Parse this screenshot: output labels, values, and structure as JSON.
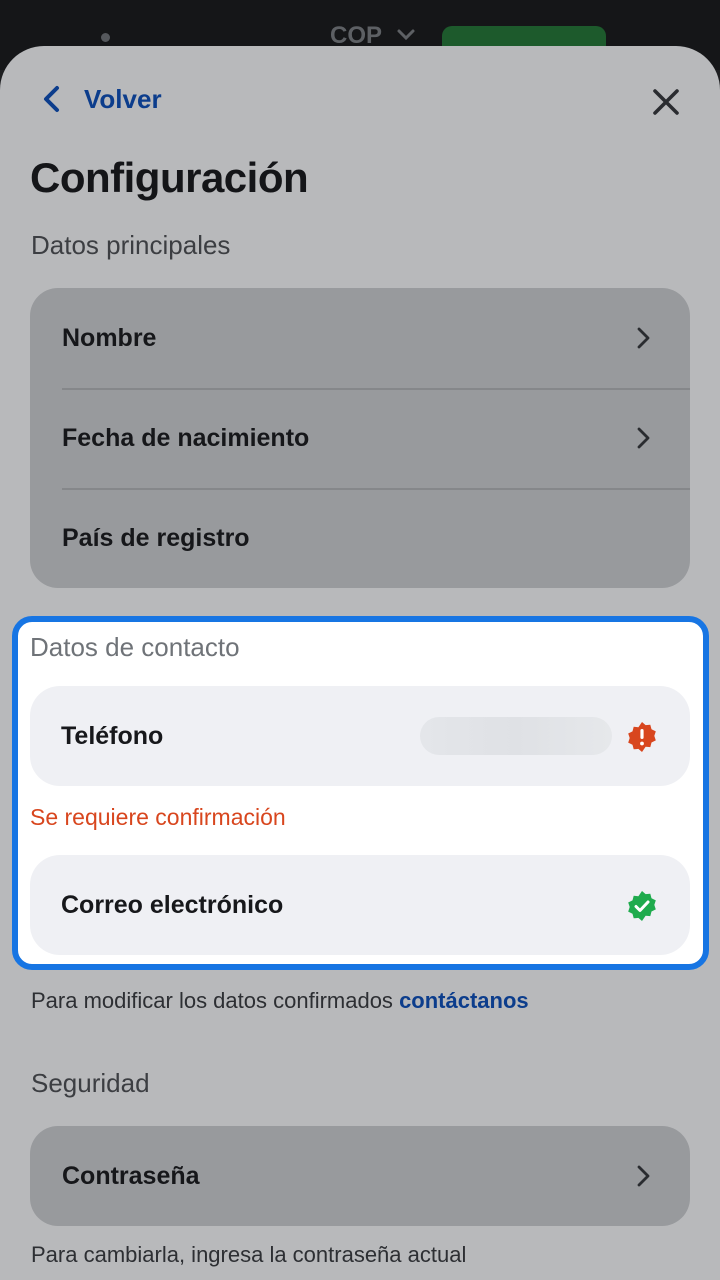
{
  "background": {
    "currency": "COP"
  },
  "header": {
    "back_label": "Volver"
  },
  "page": {
    "title": "Configuración"
  },
  "main_section": {
    "label": "Datos principales",
    "items": [
      {
        "label": "Nombre",
        "has_chevron": true
      },
      {
        "label": "Fecha de nacimiento",
        "has_chevron": true
      },
      {
        "label": "País de registro",
        "has_chevron": false
      }
    ]
  },
  "contact_section": {
    "label": "Datos de contacto",
    "phone": {
      "label": "Teléfono",
      "status_icon": "warning-icon"
    },
    "phone_warning": "Se requiere confirmación",
    "email": {
      "label": "Correo electrónico",
      "status_icon": "verified-check-icon"
    }
  },
  "contact_note": {
    "text": "Para modificar los datos confirmados ",
    "link": "contáctanos"
  },
  "security_section": {
    "label": "Seguridad",
    "password_label": "Contraseña",
    "note": "Para cambiarla, ingresa la contraseña actual"
  },
  "colors": {
    "accent_blue": "#0c3d8c",
    "highlight_border": "#1775e3",
    "warning": "#d8461e",
    "success": "#1fab4d"
  }
}
